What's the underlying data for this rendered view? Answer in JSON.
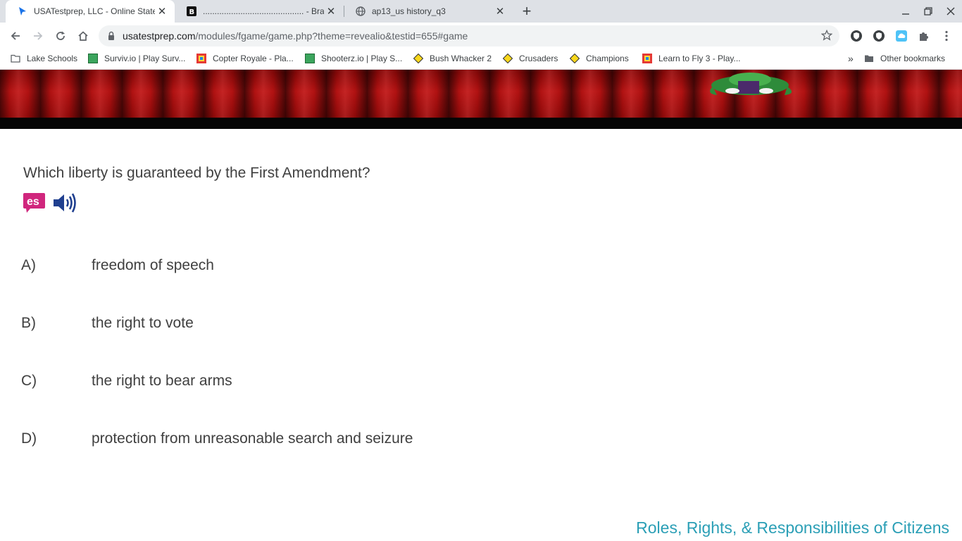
{
  "browser": {
    "tabs": [
      {
        "title": "USATestprep, LLC - Online State-S",
        "favicon": "cursor-arrow-icon",
        "active": true
      },
      {
        "title": "........................................... - Brai",
        "favicon": "brainly-b-icon",
        "active": false
      },
      {
        "title": "ap13_us history_q3",
        "favicon": "globe-icon",
        "active": false
      }
    ],
    "url_host": "usatestprep.com",
    "url_path": "/modules/fgame/game.php?theme=revealio&testid=655#game",
    "bookmarks": [
      {
        "label": "Lake Schools",
        "icon": "folder-icon"
      },
      {
        "label": "Surviv.io | Play Surv...",
        "icon": "green-square-icon"
      },
      {
        "label": "Copter Royale - Pla...",
        "icon": "multicolor-square-icon"
      },
      {
        "label": "Shooterz.io | Play S...",
        "icon": "green-square-icon"
      },
      {
        "label": "Bush Whacker 2",
        "icon": "yellow-diamond-icon"
      },
      {
        "label": "Crusaders",
        "icon": "yellow-diamond-icon"
      },
      {
        "label": "Champions",
        "icon": "yellow-diamond-icon"
      },
      {
        "label": "Learn to Fly 3 - Play...",
        "icon": "multicolor-square-icon"
      }
    ],
    "other_bookmarks": "Other bookmarks",
    "more_bookmarks": "»"
  },
  "page": {
    "question": "Which liberty is guaranteed by the First Amendment?",
    "spanish_badge": "es",
    "answers": [
      {
        "letter": "A)",
        "text": "freedom of speech"
      },
      {
        "letter": "B)",
        "text": "the right to vote"
      },
      {
        "letter": "C)",
        "text": "the right to bear arms"
      },
      {
        "letter": "D)",
        "text": "protection from unreasonable search and seizure"
      }
    ],
    "topic": "Roles, Rights, & Responsibilities of Citizens"
  },
  "colors": {
    "topic": "#2b9fb6",
    "banner_red": "#b11212",
    "es_badge": "#d0267d",
    "audio_icon": "#1f3f8f"
  }
}
